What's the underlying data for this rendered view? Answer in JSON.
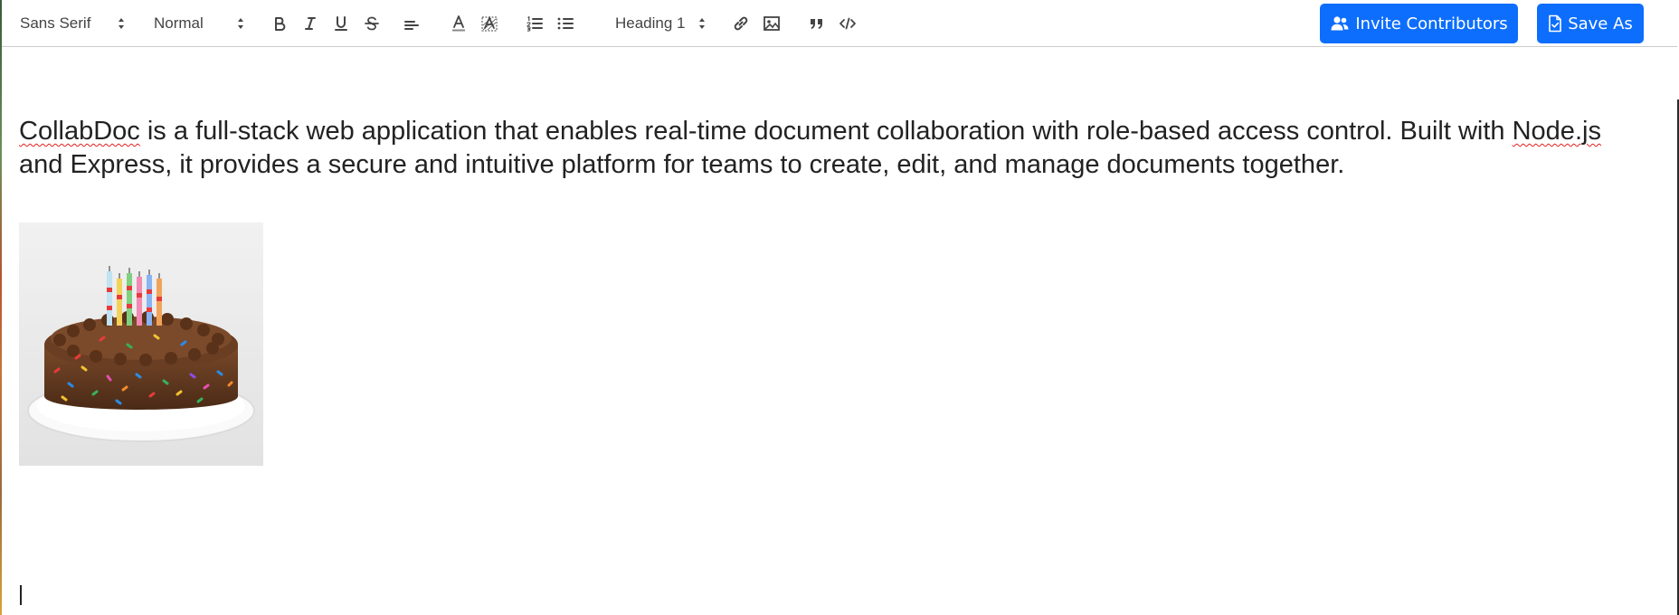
{
  "toolbar": {
    "font_family": "Sans Serif",
    "size": "Normal",
    "heading": "Heading 1",
    "invite_label": "Invite Contributors",
    "save_as_label": "Save As"
  },
  "document": {
    "text_before": " is a full-stack web application that enables real-time document collaboration with role-based access control. Built with ",
    "brand": "CollabDoc",
    "node_word": "Node.js",
    "text_after": " and Express, it provides a secure and intuitive platform for teams to create, edit, and manage documents together.",
    "image_icon": "birthday-cake-photo"
  },
  "colors": {
    "primary": "#0d6efd",
    "text": "#222222",
    "toolbar_icon": "#444444",
    "spellcheck": "#e02020"
  }
}
